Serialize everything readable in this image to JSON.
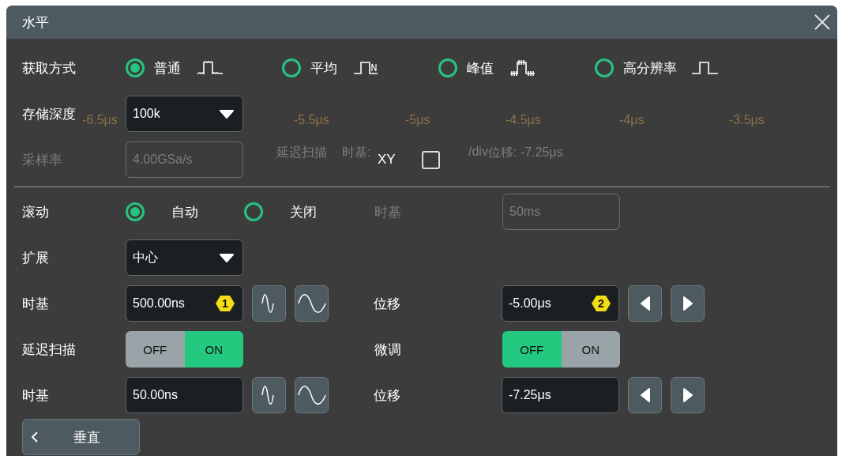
{
  "window": {
    "title": "水平"
  },
  "background": {
    "ticks": [
      "-6.5μs",
      "-5.5μs",
      "-5μs",
      "-4.5μs",
      "-4μs",
      "-3.5μs"
    ],
    "status": [
      "延迟扫描",
      "时基:",
      "/div",
      "位移: -7.25μs"
    ]
  },
  "acquisition": {
    "label": "获取方式",
    "options": [
      {
        "label": "普通",
        "selected": true,
        "kind": "normal"
      },
      {
        "label": "平均",
        "selected": false,
        "kind": "average"
      },
      {
        "label": "峰值",
        "selected": false,
        "kind": "peak"
      },
      {
        "label": "高分辨率",
        "selected": false,
        "kind": "hires"
      }
    ]
  },
  "memory_depth": {
    "label": "存储深度",
    "value": "100k"
  },
  "sample_rate": {
    "label": "采样率",
    "value": "4.00GSa/s",
    "disabled": true
  },
  "xy": {
    "label": "XY",
    "checked": false
  },
  "roll": {
    "label": "滚动",
    "options": [
      {
        "label": "自动",
        "selected": true
      },
      {
        "label": "关闭",
        "selected": false
      }
    ],
    "timebase_label": "时基",
    "timebase_value": "50ms",
    "disabled": true
  },
  "expand": {
    "label": "扩展",
    "value": "中心"
  },
  "main": {
    "timebase_label": "时基",
    "timebase": "500.00ns",
    "timebase_badge": "1",
    "offset_label": "位移",
    "offset": "-5.00μs",
    "offset_badge": "2"
  },
  "delayed": {
    "label": "延迟扫描",
    "options": [
      {
        "label": "OFF",
        "selected": false
      },
      {
        "label": "ON",
        "selected": true
      }
    ],
    "fine_label": "微调",
    "fine_options": [
      {
        "label": "OFF",
        "selected": true
      },
      {
        "label": "ON",
        "selected": false
      }
    ]
  },
  "delayed_timebase": {
    "timebase_label": "时基",
    "timebase": "50.00ns",
    "offset_label": "位移",
    "offset": "-7.25μs"
  },
  "back_button": {
    "label": "垂直"
  }
}
